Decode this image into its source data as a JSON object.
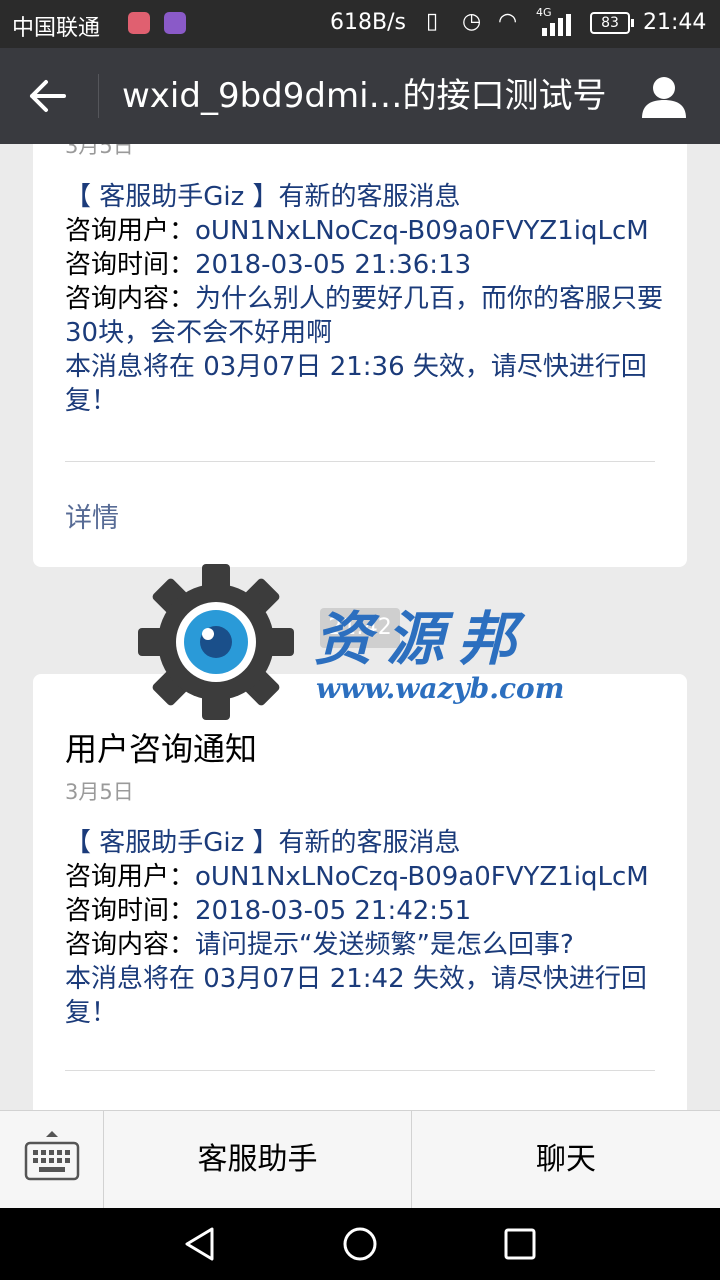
{
  "status_bar": {
    "carrier": "中国联通",
    "speed": "618B/s",
    "network": "4G",
    "battery": "83",
    "time": "21:44"
  },
  "header": {
    "back_icon": "back-arrow-icon",
    "title": "wxid_9bd9dmi…的接口测试号",
    "profile_icon": "user-profile-icon"
  },
  "messages": [
    {
      "partial_date": "3月5日",
      "intro": "【 客服助手Giz 】有新的客服消息",
      "user_label": "咨询用户：",
      "user_value": "oUN1NxLNoCzq-B09a0FVYZ1iqLcM",
      "time_label": "咨询时间：",
      "time_value": "2018-03-05 21:36:13",
      "content_label": "咨询内容：",
      "content_value": "为什么别人的要好几百，而你的客服只要30块，会不会不好用啊",
      "expiry": "本消息将在 03月07日 21:36 失效，请尽快进行回复！",
      "detail": "详情"
    },
    {
      "timestamp": "21:42",
      "title": "用户咨询通知",
      "date": "3月5日",
      "intro": "【 客服助手Giz 】有新的客服消息",
      "user_label": "咨询用户：",
      "user_value": "oUN1NxLNoCzq-B09a0FVYZ1iqLcM",
      "time_label": "咨询时间：",
      "time_value": "2018-03-05 21:42:51",
      "content_label": "咨询内容：",
      "content_value": "请问提示“发送频繁”是怎么回事?",
      "expiry": "本消息将在 03月07日 21:42 失效，请尽快进行回复！"
    }
  ],
  "watermark": {
    "text": "资源邦",
    "url": "www.wazyb.com"
  },
  "bottom_menu": {
    "keyboard_icon": "keyboard-icon",
    "items": [
      "客服助手",
      "聊天"
    ]
  },
  "nav_bar": {
    "icons": [
      "back-triangle-icon",
      "home-circle-icon",
      "recents-square-icon"
    ]
  },
  "colors": {
    "header_bg": "#393a3f",
    "status_bg": "#2b2b2b",
    "value_text": "#1b3b7a",
    "link": "#576b95",
    "feed_bg": "#ebebeb"
  }
}
